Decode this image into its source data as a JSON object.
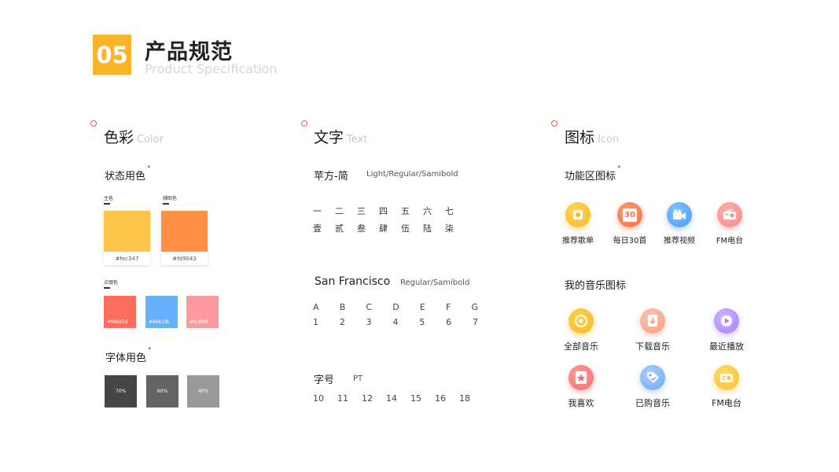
{
  "header": {
    "badge": "05",
    "title": "产品规范",
    "subtitle": "Product Specification"
  },
  "color_section": {
    "title": "色彩",
    "title_en": "Color",
    "state_title": "状态用色",
    "primary_label": "主色",
    "primary_hex": "#fec347",
    "secondary_label": "辅助色",
    "secondary_hex": "#fd9043",
    "accent_label": "点缀色",
    "accents": [
      "#fd6d5d",
      "#66b1fb",
      "#fc9b9f"
    ],
    "font_title": "字体用色",
    "grays": [
      "70%",
      "60%",
      "40%"
    ]
  },
  "text_section": {
    "title": "文字",
    "title_en": "Text",
    "font1_name": "苹方-简",
    "font1_weights": "Light/Regular/Samibold",
    "row1": [
      "一",
      "二",
      "三",
      "四",
      "五",
      "六",
      "七"
    ],
    "row2": [
      "壹",
      "贰",
      "叁",
      "肆",
      "伍",
      "陆",
      "柒"
    ],
    "font2_name": "San Francisco",
    "font2_weights": "Regular/Samibold",
    "letters": [
      "A",
      "B",
      "C",
      "D",
      "E",
      "F",
      "G"
    ],
    "digits": [
      "1",
      "2",
      "3",
      "4",
      "5",
      "6",
      "7"
    ],
    "size_title": "字号",
    "size_unit": "PT",
    "sizes": [
      "10",
      "11",
      "12",
      "14",
      "15",
      "16",
      "18"
    ]
  },
  "icon_section": {
    "title": "图标",
    "title_en": "Icon",
    "func_title": "功能区图标",
    "func_icons": [
      {
        "label": "推荐歌单",
        "icon": "playlist-icon"
      },
      {
        "label": "每日30首",
        "icon": "calendar-30-icon",
        "glyph": "30"
      },
      {
        "label": "推荐视频",
        "icon": "video-camera-icon"
      },
      {
        "label": "FM电台",
        "icon": "radio-icon"
      }
    ],
    "my_title": "我的音乐图标",
    "my_icons": [
      {
        "label": "全部音乐",
        "icon": "vinyl-icon"
      },
      {
        "label": "下载音乐",
        "icon": "download-icon"
      },
      {
        "label": "最近播放",
        "icon": "recent-play-icon"
      },
      {
        "label": "我喜欢",
        "icon": "favorite-star-icon"
      },
      {
        "label": "已购音乐",
        "icon": "purchased-tag-icon"
      },
      {
        "label": "FM电台",
        "icon": "radio-icon"
      }
    ]
  }
}
